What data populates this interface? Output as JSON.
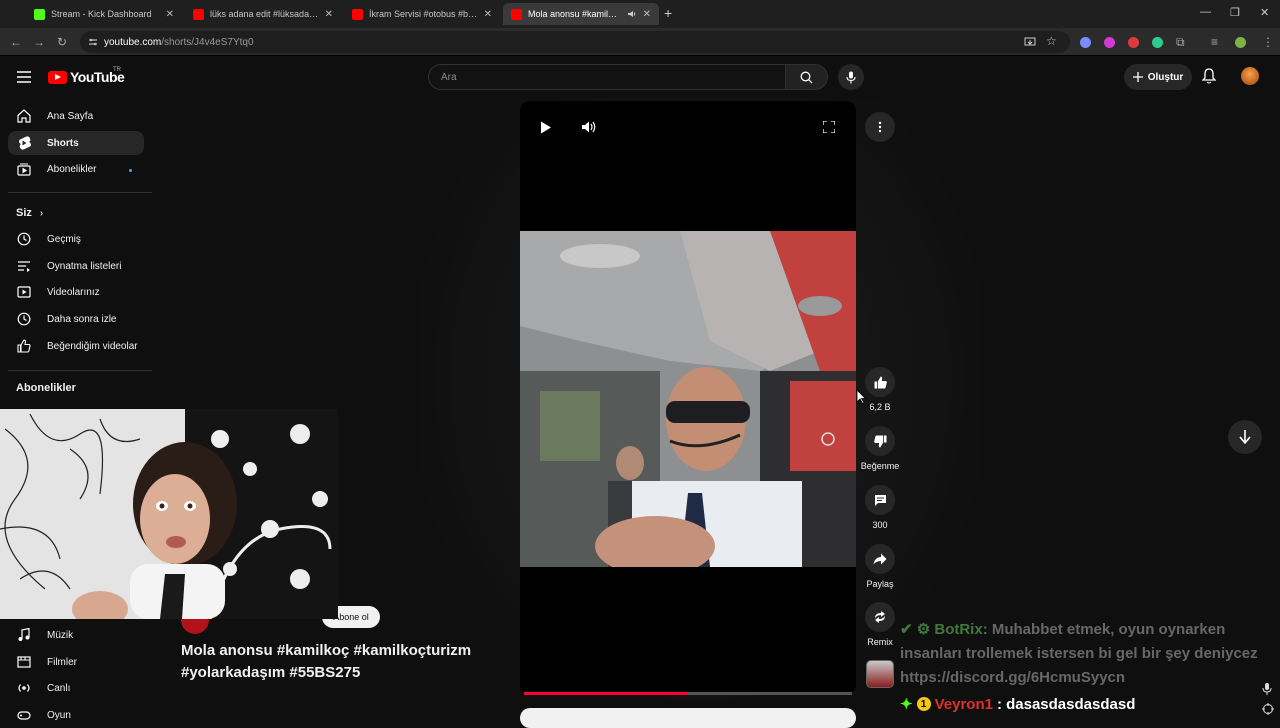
{
  "browser": {
    "tabs": [
      {
        "title": "Stream - Kick Dashboard",
        "favicon_color": "#53fc18"
      },
      {
        "title": "lüks adana edit #lüksadana #lü",
        "favicon_color": "#ff0000"
      },
      {
        "title": "İkram Servisi #otobus #bus - Yo",
        "favicon_color": "#ff0000"
      },
      {
        "title": "Mola anonsu #kamilkoç #ka",
        "favicon_color": "#ff0000"
      }
    ],
    "new_tab": "+",
    "url_site": "youtube.com",
    "url_path": "/shorts/J4v4eS7Ytq0"
  },
  "masthead": {
    "logo_text": "YouTube",
    "country": "TR",
    "search_placeholder": "Ara",
    "create_label": "Oluştur"
  },
  "sidebar": {
    "main": [
      {
        "label": "Ana Sayfa",
        "icon": "home-icon"
      },
      {
        "label": "Shorts",
        "icon": "shorts-icon"
      },
      {
        "label": "Abonelikler",
        "icon": "subscriptions-icon"
      }
    ],
    "you_heading": "Siz",
    "you": [
      {
        "label": "Geçmiş",
        "icon": "history-icon"
      },
      {
        "label": "Oynatma listeleri",
        "icon": "playlists-icon"
      },
      {
        "label": "Videolarınız",
        "icon": "your-videos-icon"
      },
      {
        "label": "Daha sonra izle",
        "icon": "watch-later-icon"
      },
      {
        "label": "Beğendiğim videolar",
        "icon": "liked-videos-icon"
      }
    ],
    "subs_heading": "Abonelikler",
    "explore": [
      {
        "label": "Müzik",
        "icon": "music-icon"
      },
      {
        "label": "Filmler",
        "icon": "movies-icon"
      },
      {
        "label": "Canlı",
        "icon": "live-icon"
      },
      {
        "label": "Oyun",
        "icon": "gaming-icon"
      }
    ]
  },
  "short": {
    "likes": "6,2 B",
    "dislike_label": "Beğenme",
    "comments": "300",
    "share_label": "Paylaş",
    "remix_label": "Remix",
    "subscribe_label": "Abone ol",
    "title": "Mola anonsu #kamilkoç #kamilkoçturizm #yolarkadaşım #55BS275",
    "progress": 0.5
  },
  "chat": {
    "msg1_user": "BotRix",
    "msg1_text": ": Muhabbet etmek, oyun oynarken insanları trollemek istersen bi gel bir şey deniycez https://discord.gg/6HcmuSyycn",
    "msg2_user": "Veyron1",
    "msg2_text": ": dasasdasdasdasd"
  },
  "colors": {
    "brand_red": "#ff0000",
    "bg": "#0f0f0f",
    "accent_blue": "#3ea6ff"
  }
}
